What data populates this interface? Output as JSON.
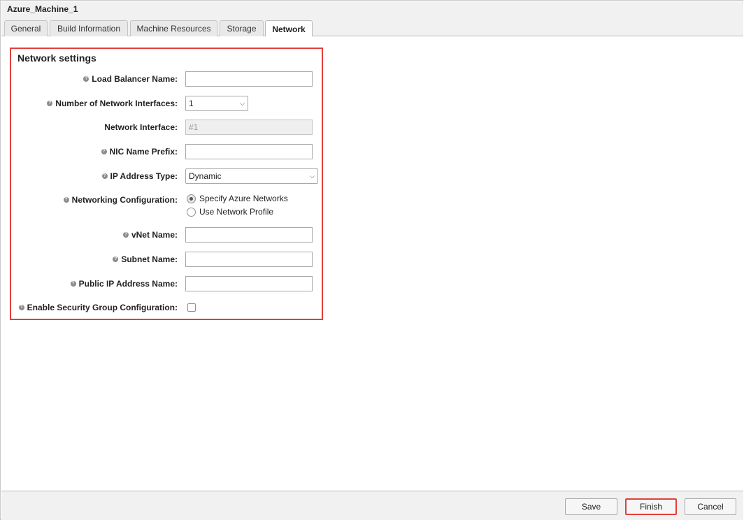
{
  "window": {
    "title": "Azure_Machine_1"
  },
  "tabs": [
    {
      "label": "General"
    },
    {
      "label": "Build Information"
    },
    {
      "label": "Machine Resources"
    },
    {
      "label": "Storage"
    },
    {
      "label": "Network",
      "active": true
    }
  ],
  "section": {
    "title": "Network settings",
    "fields": {
      "load_balancer": {
        "label": "Load Balancer Name:",
        "value": ""
      },
      "num_interfaces": {
        "label": "Number of Network Interfaces:",
        "value": "1"
      },
      "network_interface": {
        "label": "Network Interface:",
        "value": "#1"
      },
      "nic_prefix": {
        "label": "NIC Name Prefix:",
        "value": ""
      },
      "ip_type": {
        "label": "IP Address Type:",
        "value": "Dynamic"
      },
      "net_config": {
        "label": "Networking Configuration:",
        "options": [
          "Specify Azure Networks",
          "Use Network Profile"
        ],
        "selected": "Specify Azure Networks"
      },
      "vnet": {
        "label": "vNet Name:",
        "value": ""
      },
      "subnet": {
        "label": "Subnet Name:",
        "value": ""
      },
      "public_ip": {
        "label": "Public IP Address Name:",
        "value": ""
      },
      "security_group": {
        "label": "Enable Security Group Configuration:",
        "checked": false
      }
    }
  },
  "footer": {
    "save": "Save",
    "finish": "Finish",
    "cancel": "Cancel"
  },
  "colors": {
    "highlight": "#e0403a"
  },
  "icons": {
    "help": "help-icon",
    "dropdown": "chevron-down-icon"
  }
}
